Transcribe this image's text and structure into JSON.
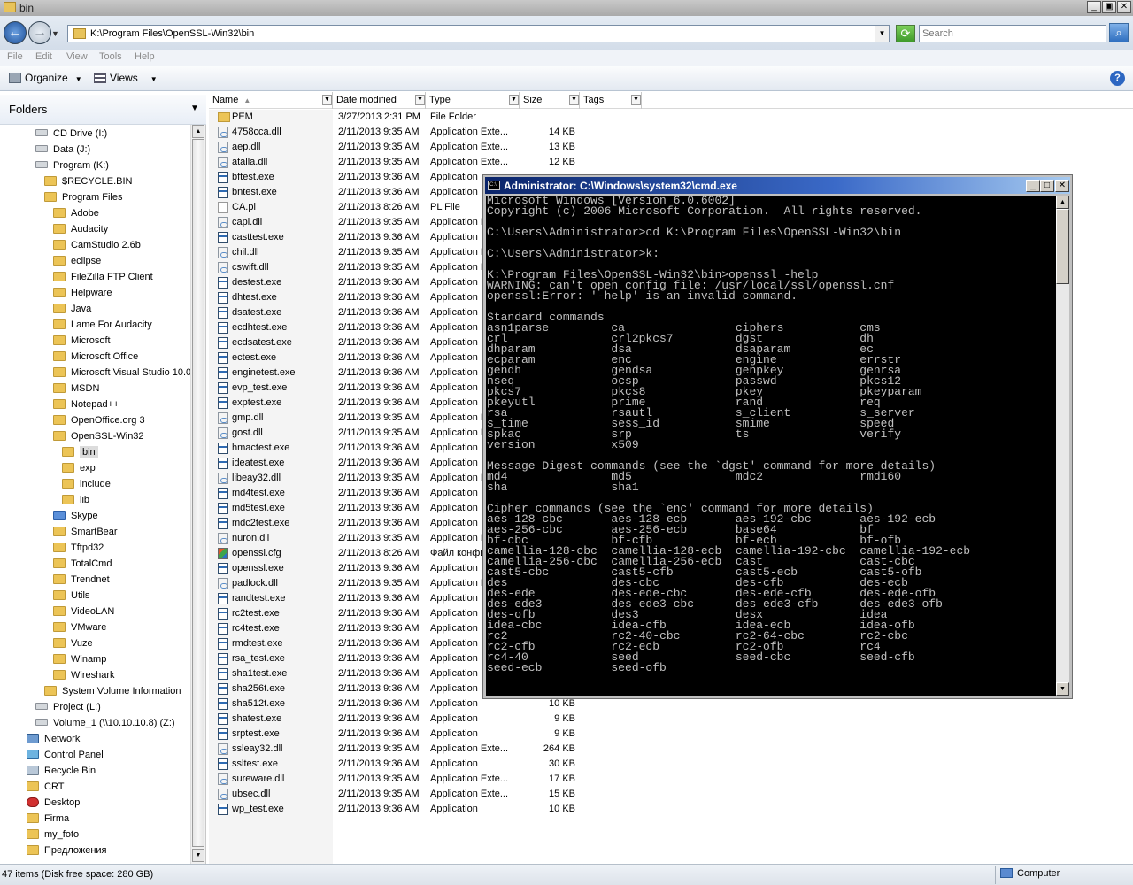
{
  "window": {
    "title": "bin"
  },
  "address": {
    "path": "K:\\Program Files\\OpenSSL-Win32\\bin",
    "search_placeholder": "Search"
  },
  "menu": [
    "File",
    "Edit",
    "View",
    "Tools",
    "Help"
  ],
  "toolbar": {
    "organize": "Organize",
    "views": "Views"
  },
  "nav": {
    "header": "Folders",
    "items": [
      {
        "label": "CD Drive (I:)",
        "indent": 0,
        "icon": "drive"
      },
      {
        "label": "Data (J:)",
        "indent": 0,
        "icon": "drive"
      },
      {
        "label": "Program (K:)",
        "indent": 0,
        "icon": "drive"
      },
      {
        "label": "$RECYCLE.BIN",
        "indent": 1,
        "icon": "folder"
      },
      {
        "label": "Program Files",
        "indent": 1,
        "icon": "folder"
      },
      {
        "label": "Adobe",
        "indent": 2,
        "icon": "folder"
      },
      {
        "label": "Audacity",
        "indent": 2,
        "icon": "folder"
      },
      {
        "label": "CamStudio 2.6b",
        "indent": 2,
        "icon": "folder"
      },
      {
        "label": "eclipse",
        "indent": 2,
        "icon": "folder"
      },
      {
        "label": "FileZilla FTP Client",
        "indent": 2,
        "icon": "folder"
      },
      {
        "label": "Helpware",
        "indent": 2,
        "icon": "folder"
      },
      {
        "label": "Java",
        "indent": 2,
        "icon": "folder"
      },
      {
        "label": "Lame For Audacity",
        "indent": 2,
        "icon": "folder"
      },
      {
        "label": "Microsoft",
        "indent": 2,
        "icon": "folder"
      },
      {
        "label": "Microsoft Office",
        "indent": 2,
        "icon": "folder"
      },
      {
        "label": "Microsoft Visual Studio 10.0",
        "indent": 2,
        "icon": "folder"
      },
      {
        "label": "MSDN",
        "indent": 2,
        "icon": "folder"
      },
      {
        "label": "Notepad++",
        "indent": 2,
        "icon": "folder"
      },
      {
        "label": "OpenOffice.org 3",
        "indent": 2,
        "icon": "folder"
      },
      {
        "label": "OpenSSL-Win32",
        "indent": 2,
        "icon": "folder"
      },
      {
        "label": "bin",
        "indent": 3,
        "icon": "folder",
        "selected": true
      },
      {
        "label": "exp",
        "indent": 3,
        "icon": "folder"
      },
      {
        "label": "include",
        "indent": 3,
        "icon": "folder"
      },
      {
        "label": "lib",
        "indent": 3,
        "icon": "folder"
      },
      {
        "label": "Skype",
        "indent": 2,
        "icon": "sky"
      },
      {
        "label": "SmartBear",
        "indent": 2,
        "icon": "folder"
      },
      {
        "label": "Tftpd32",
        "indent": 2,
        "icon": "folder"
      },
      {
        "label": "TotalCmd",
        "indent": 2,
        "icon": "folder"
      },
      {
        "label": "Trendnet",
        "indent": 2,
        "icon": "folder"
      },
      {
        "label": "Utils",
        "indent": 2,
        "icon": "folder"
      },
      {
        "label": "VideoLAN",
        "indent": 2,
        "icon": "folder"
      },
      {
        "label": "VMware",
        "indent": 2,
        "icon": "folder"
      },
      {
        "label": "Vuze",
        "indent": 2,
        "icon": "folder"
      },
      {
        "label": "Winamp",
        "indent": 2,
        "icon": "folder"
      },
      {
        "label": "Wireshark",
        "indent": 2,
        "icon": "folder"
      },
      {
        "label": "System Volume Information",
        "indent": 1,
        "icon": "folder"
      },
      {
        "label": "Project (L:)",
        "indent": 0,
        "icon": "drive"
      },
      {
        "label": "Volume_1 (\\\\10.10.10.8) (Z:)",
        "indent": 0,
        "icon": "drive"
      },
      {
        "label": "Network",
        "indent": -1,
        "icon": "net"
      },
      {
        "label": "Control Panel",
        "indent": -1,
        "icon": "cp"
      },
      {
        "label": "Recycle Bin",
        "indent": -1,
        "icon": "bin"
      },
      {
        "label": "CRT",
        "indent": -1,
        "icon": "folder"
      },
      {
        "label": "Desktop",
        "indent": -1,
        "icon": "desk"
      },
      {
        "label": "Firma",
        "indent": -1,
        "icon": "folder"
      },
      {
        "label": "my_foto",
        "indent": -1,
        "icon": "folder"
      },
      {
        "label": "Предложения",
        "indent": -1,
        "icon": "folder"
      }
    ]
  },
  "columns": [
    "Name",
    "Date modified",
    "Type",
    "Size",
    "Tags"
  ],
  "files": [
    {
      "name": "PEM",
      "date": "3/27/2013 2:31 PM",
      "type": "File Folder",
      "size": "",
      "icon": "folder"
    },
    {
      "name": "4758cca.dll",
      "date": "2/11/2013 9:35 AM",
      "type": "Application Exte...",
      "size": "14 KB",
      "icon": "dll"
    },
    {
      "name": "aep.dll",
      "date": "2/11/2013 9:35 AM",
      "type": "Application Exte...",
      "size": "13 KB",
      "icon": "dll"
    },
    {
      "name": "atalla.dll",
      "date": "2/11/2013 9:35 AM",
      "type": "Application Exte...",
      "size": "12 KB",
      "icon": "dll"
    },
    {
      "name": "bftest.exe",
      "date": "2/11/2013 9:36 AM",
      "type": "Application",
      "size": "",
      "icon": "exe"
    },
    {
      "name": "bntest.exe",
      "date": "2/11/2013 9:36 AM",
      "type": "Application",
      "size": "",
      "icon": "exe"
    },
    {
      "name": "CA.pl",
      "date": "2/11/2013 8:26 AM",
      "type": "PL File",
      "size": "",
      "icon": "pl"
    },
    {
      "name": "capi.dll",
      "date": "2/11/2013 9:35 AM",
      "type": "Application E",
      "size": "",
      "icon": "dll"
    },
    {
      "name": "casttest.exe",
      "date": "2/11/2013 9:36 AM",
      "type": "Application",
      "size": "",
      "icon": "exe"
    },
    {
      "name": "chil.dll",
      "date": "2/11/2013 9:35 AM",
      "type": "Application E",
      "size": "",
      "icon": "dll"
    },
    {
      "name": "cswift.dll",
      "date": "2/11/2013 9:35 AM",
      "type": "Application E",
      "size": "",
      "icon": "dll"
    },
    {
      "name": "destest.exe",
      "date": "2/11/2013 9:36 AM",
      "type": "Application",
      "size": "",
      "icon": "exe"
    },
    {
      "name": "dhtest.exe",
      "date": "2/11/2013 9:36 AM",
      "type": "Application",
      "size": "",
      "icon": "exe"
    },
    {
      "name": "dsatest.exe",
      "date": "2/11/2013 9:36 AM",
      "type": "Application",
      "size": "",
      "icon": "exe"
    },
    {
      "name": "ecdhtest.exe",
      "date": "2/11/2013 9:36 AM",
      "type": "Application",
      "size": "",
      "icon": "exe"
    },
    {
      "name": "ecdsatest.exe",
      "date": "2/11/2013 9:36 AM",
      "type": "Application",
      "size": "",
      "icon": "exe"
    },
    {
      "name": "ectest.exe",
      "date": "2/11/2013 9:36 AM",
      "type": "Application",
      "size": "",
      "icon": "exe"
    },
    {
      "name": "enginetest.exe",
      "date": "2/11/2013 9:36 AM",
      "type": "Application",
      "size": "",
      "icon": "exe"
    },
    {
      "name": "evp_test.exe",
      "date": "2/11/2013 9:36 AM",
      "type": "Application",
      "size": "",
      "icon": "exe"
    },
    {
      "name": "exptest.exe",
      "date": "2/11/2013 9:36 AM",
      "type": "Application",
      "size": "",
      "icon": "exe"
    },
    {
      "name": "gmp.dll",
      "date": "2/11/2013 9:35 AM",
      "type": "Application E",
      "size": "",
      "icon": "dll"
    },
    {
      "name": "gost.dll",
      "date": "2/11/2013 9:35 AM",
      "type": "Application E",
      "size": "",
      "icon": "dll"
    },
    {
      "name": "hmactest.exe",
      "date": "2/11/2013 9:36 AM",
      "type": "Application",
      "size": "",
      "icon": "exe"
    },
    {
      "name": "ideatest.exe",
      "date": "2/11/2013 9:36 AM",
      "type": "Application",
      "size": "",
      "icon": "exe"
    },
    {
      "name": "libeay32.dll",
      "date": "2/11/2013 9:35 AM",
      "type": "Application E",
      "size": "",
      "icon": "dll"
    },
    {
      "name": "md4test.exe",
      "date": "2/11/2013 9:36 AM",
      "type": "Application",
      "size": "",
      "icon": "exe"
    },
    {
      "name": "md5test.exe",
      "date": "2/11/2013 9:36 AM",
      "type": "Application",
      "size": "",
      "icon": "exe"
    },
    {
      "name": "mdc2test.exe",
      "date": "2/11/2013 9:36 AM",
      "type": "Application",
      "size": "",
      "icon": "exe"
    },
    {
      "name": "nuron.dll",
      "date": "2/11/2013 9:35 AM",
      "type": "Application E",
      "size": "",
      "icon": "dll"
    },
    {
      "name": "openssl.cfg",
      "date": "2/11/2013 8:26 AM",
      "type": "Файл конфи",
      "size": "",
      "icon": "cfg"
    },
    {
      "name": "openssl.exe",
      "date": "2/11/2013 9:36 AM",
      "type": "Application",
      "size": "",
      "icon": "exe"
    },
    {
      "name": "padlock.dll",
      "date": "2/11/2013 9:35 AM",
      "type": "Application E",
      "size": "",
      "icon": "dll"
    },
    {
      "name": "randtest.exe",
      "date": "2/11/2013 9:36 AM",
      "type": "Application",
      "size": "",
      "icon": "exe"
    },
    {
      "name": "rc2test.exe",
      "date": "2/11/2013 9:36 AM",
      "type": "Application",
      "size": "",
      "icon": "exe"
    },
    {
      "name": "rc4test.exe",
      "date": "2/11/2013 9:36 AM",
      "type": "Application",
      "size": "",
      "icon": "exe"
    },
    {
      "name": "rmdtest.exe",
      "date": "2/11/2013 9:36 AM",
      "type": "Application",
      "size": "",
      "icon": "exe"
    },
    {
      "name": "rsa_test.exe",
      "date": "2/11/2013 9:36 AM",
      "type": "Application",
      "size": "",
      "icon": "exe"
    },
    {
      "name": "sha1test.exe",
      "date": "2/11/2013 9:36 AM",
      "type": "Application",
      "size": "",
      "icon": "exe"
    },
    {
      "name": "sha256t.exe",
      "date": "2/11/2013 9:36 AM",
      "type": "Application",
      "size": "",
      "icon": "exe"
    },
    {
      "name": "sha512t.exe",
      "date": "2/11/2013 9:36 AM",
      "type": "Application",
      "size": "10 KB",
      "icon": "exe"
    },
    {
      "name": "shatest.exe",
      "date": "2/11/2013 9:36 AM",
      "type": "Application",
      "size": "9 KB",
      "icon": "exe"
    },
    {
      "name": "srptest.exe",
      "date": "2/11/2013 9:36 AM",
      "type": "Application",
      "size": "9 KB",
      "icon": "exe"
    },
    {
      "name": "ssleay32.dll",
      "date": "2/11/2013 9:35 AM",
      "type": "Application Exte...",
      "size": "264 KB",
      "icon": "dll"
    },
    {
      "name": "ssltest.exe",
      "date": "2/11/2013 9:36 AM",
      "type": "Application",
      "size": "30 KB",
      "icon": "exe"
    },
    {
      "name": "sureware.dll",
      "date": "2/11/2013 9:35 AM",
      "type": "Application Exte...",
      "size": "17 KB",
      "icon": "dll"
    },
    {
      "name": "ubsec.dll",
      "date": "2/11/2013 9:35 AM",
      "type": "Application Exte...",
      "size": "15 KB",
      "icon": "dll"
    },
    {
      "name": "wp_test.exe",
      "date": "2/11/2013 9:36 AM",
      "type": "Application",
      "size": "10 KB",
      "icon": "exe"
    }
  ],
  "status": {
    "text": "47 items (Disk free space: 280 GB)",
    "location": "Computer"
  },
  "cmd": {
    "title": "Administrator: C:\\Windows\\system32\\cmd.exe",
    "lines": [
      "Microsoft Windows [Version 6.0.6002]",
      "Copyright (c) 2006 Microsoft Corporation.  All rights reserved.",
      "",
      "C:\\Users\\Administrator>cd K:\\Program Files\\OpenSSL-Win32\\bin",
      "",
      "C:\\Users\\Administrator>k:",
      "",
      "K:\\Program Files\\OpenSSL-Win32\\bin>openssl -help",
      "WARNING: can't open config file: /usr/local/ssl/openssl.cnf",
      "openssl:Error: '-help' is an invalid command.",
      "",
      "Standard commands",
      "asn1parse         ca                ciphers           cms",
      "crl               crl2pkcs7         dgst              dh",
      "dhparam           dsa               dsaparam          ec",
      "ecparam           enc               engine            errstr",
      "gendh             gendsa            genpkey           genrsa",
      "nseq              ocsp              passwd            pkcs12",
      "pkcs7             pkcs8             pkey              pkeyparam",
      "pkeyutl           prime             rand              req",
      "rsa               rsautl            s_client          s_server",
      "s_time            sess_id           smime             speed",
      "spkac             srp               ts                verify",
      "version           x509",
      "",
      "Message Digest commands (see the `dgst' command for more details)",
      "md4               md5               mdc2              rmd160",
      "sha               sha1",
      "",
      "Cipher commands (see the `enc' command for more details)",
      "aes-128-cbc       aes-128-ecb       aes-192-cbc       aes-192-ecb",
      "aes-256-cbc       aes-256-ecb       base64            bf",
      "bf-cbc            bf-cfb            bf-ecb            bf-ofb",
      "camellia-128-cbc  camellia-128-ecb  camellia-192-cbc  camellia-192-ecb",
      "camellia-256-cbc  camellia-256-ecb  cast              cast-cbc",
      "cast5-cbc         cast5-cfb         cast5-ecb         cast5-ofb",
      "des               des-cbc           des-cfb           des-ecb",
      "des-ede           des-ede-cbc       des-ede-cfb       des-ede-ofb",
      "des-ede3          des-ede3-cbc      des-ede3-cfb      des-ede3-ofb",
      "des-ofb           des3              desx              idea",
      "idea-cbc          idea-cfb          idea-ecb          idea-ofb",
      "rc2               rc2-40-cbc        rc2-64-cbc        rc2-cbc",
      "rc2-cfb           rc2-ecb           rc2-ofb           rc4",
      "rc4-40            seed              seed-cbc          seed-cfb",
      "seed-ecb          seed-ofb"
    ]
  }
}
